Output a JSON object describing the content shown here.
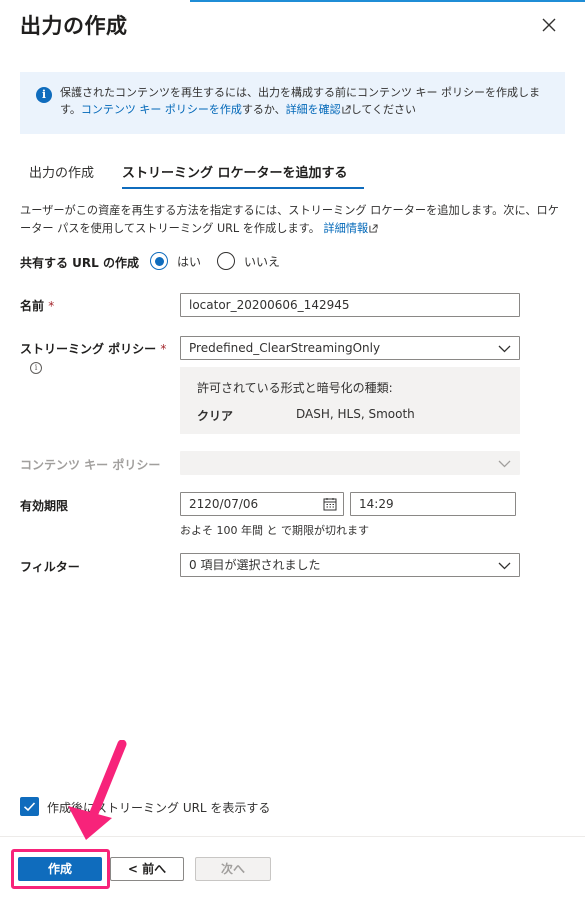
{
  "header": {
    "title": "出力の作成"
  },
  "info_banner": {
    "text_1": "保護されたコンテンツを再生するには、出力を構成する前にコンテンツ キー ポリシーを作成します。",
    "link_create": "コンテンツ キー ポリシーを作成",
    "text_2": "するか、",
    "link_details": "詳細を確認",
    "text_3": "してください"
  },
  "tabs": [
    {
      "label": "出力の作成"
    },
    {
      "label": "ストリーミング ロケーターを追加する"
    }
  ],
  "description": {
    "text": "ユーザーがこの資産を再生する方法を指定するには、ストリーミング ロケーターを追加します。次に、ロケーター パスを使用してストリーミング URL を作成します。",
    "link": "詳細情報"
  },
  "form": {
    "shared_url_label": "共有する URL の作成",
    "radio_yes": "はい",
    "radio_no": "いいえ",
    "radio_selected": "はい",
    "name_label": "名前",
    "name_value": "locator_20200606_142945",
    "streaming_policy_label": "ストリーミング ポリシー",
    "streaming_policy_value": "Predefined_ClearStreamingOnly",
    "policy_box_heading": "許可されている形式と暗号化の種類:",
    "policy_box_key": "クリア",
    "policy_box_value": "DASH, HLS, Smooth",
    "content_key_label": "コンテンツ キー ポリシー",
    "content_key_value": "",
    "expiry_label": "有効期限",
    "expiry_date": "2120/07/06",
    "expiry_time": "14:29",
    "expiry_hint": "およそ 100 年間 と で期限が切れます",
    "filter_label": "フィルター",
    "filter_value": "0 項目が選択されました",
    "required_mark": "*"
  },
  "checkbox": {
    "label": "作成後にストリーミング URL を表示する",
    "checked": true
  },
  "footer": {
    "create_label": "作成",
    "prev_label": "< 前へ",
    "next_label": "次へ"
  },
  "colors": {
    "accent": "#0f6cbd",
    "annotation": "#f7237a",
    "info_bg": "#ebf3fc"
  },
  "icons": [
    "close-icon",
    "info-icon",
    "external-link-icon",
    "chevron-down-icon",
    "calendar-icon",
    "checkmark-icon",
    "arrow-annotation"
  ]
}
